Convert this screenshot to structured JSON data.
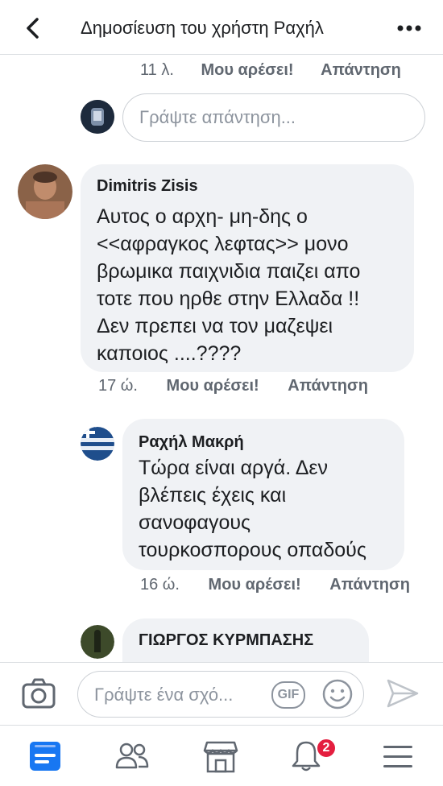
{
  "header": {
    "title": "Δημοσίευση του χρήστη Ραχήλ"
  },
  "top_reply_meta": {
    "time": "11 λ.",
    "like": "Μου αρέσει!",
    "reply": "Απάντηση"
  },
  "reply_input": {
    "placeholder": "Γράψτε απάντηση..."
  },
  "comments": [
    {
      "author": "Dimitris Zisis",
      "text": "Αυτος ο αρχη- μη-δης ο\n<<αφραγκος λεφτας>>  μονο\nβρωμικα παιχνιδια παιζει απο\nτοτε που ηρθε στην Ελλαδα  !!\nΔεν πρεπει να τον μαζεψει\nκαποιος ....????",
      "time": "17 ώ.",
      "like": "Μου αρέσει!",
      "reply": "Απάντηση"
    },
    {
      "author": "Ραχήλ Μακρή",
      "text": "Τώρα είναι αργά. Δεν\nβλέπεις έχεις και\nσανοφαγους\nτουρκοσπορους οπαδούς",
      "time": "16 ώ.",
      "like": "Μου αρέσει!",
      "reply": "Απάντηση"
    },
    {
      "author": "ΓΙΩΡΓΟΣ ΚΥΡΜΠΑΣΗΣ"
    }
  ],
  "composer": {
    "placeholder": "Γράψτε ένα σχό...",
    "gif_label": "GIF"
  },
  "tabbar": {
    "notifications_count": "2"
  },
  "colors": {
    "accent": "#1877f2",
    "bubble": "#f0f2f5",
    "meta": "#606770",
    "badge": "#e41e3f"
  },
  "icons": [
    "back-arrow-icon",
    "more-dots-icon",
    "camera-icon",
    "emoji-icon",
    "send-icon",
    "news-feed-icon",
    "friends-icon",
    "marketplace-icon",
    "bell-icon",
    "menu-icon"
  ]
}
